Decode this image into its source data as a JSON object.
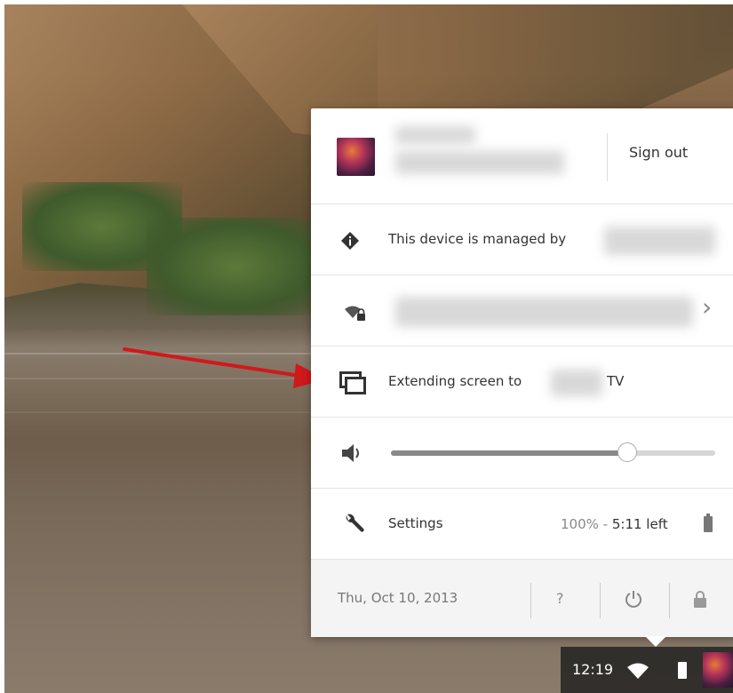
{
  "user": {
    "sign_out_label": "Sign out"
  },
  "managed": {
    "label": "This device is managed by"
  },
  "network": {
    "icon": "wifi-lock-icon",
    "chevron": "›"
  },
  "cast": {
    "label_prefix": "Extending screen to",
    "label_suffix": "TV"
  },
  "volume": {
    "level": 0.73
  },
  "settings": {
    "label": "Settings",
    "battery_percent": "100%",
    "battery_separator": " - ",
    "battery_time": "5:11 left"
  },
  "footer": {
    "date": "Thu, Oct 10, 2013",
    "help_label": "?"
  },
  "shelf": {
    "time": "12:19"
  },
  "colors": {
    "annotation_arrow": "#d0191b",
    "shelf_background": "#1e1e1e"
  }
}
